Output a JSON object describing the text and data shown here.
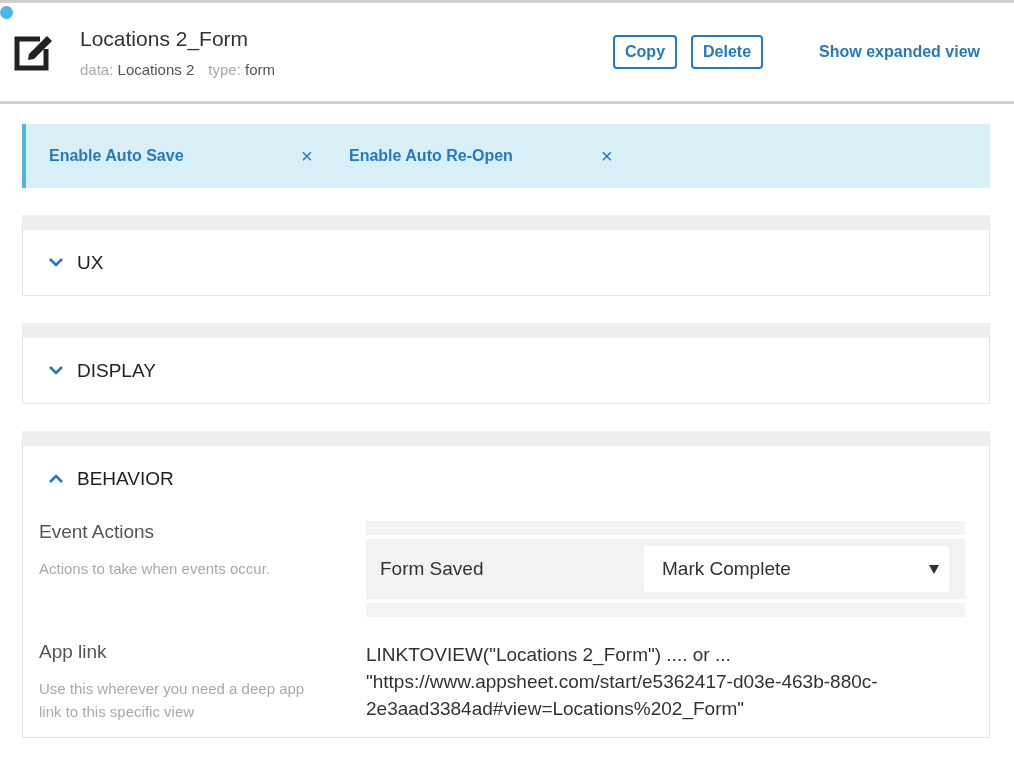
{
  "header": {
    "title": "Locations 2_Form",
    "meta": [
      {
        "label": "data:",
        "value": "Locations 2"
      },
      {
        "label": "type:",
        "value": "form"
      }
    ],
    "buttons": [
      "Copy",
      "Delete"
    ],
    "link": "Show expanded view"
  },
  "banner": {
    "items": [
      {
        "label": "Enable Auto Save",
        "close": "×"
      },
      {
        "label": "Enable Auto Re-Open",
        "close": "×"
      }
    ]
  },
  "sections": [
    {
      "title": "UX",
      "expanded": false
    },
    {
      "title": "DISPLAY",
      "expanded": false
    },
    {
      "title": "BEHAVIOR",
      "expanded": true,
      "settings": [
        {
          "kind": "event-actions",
          "label": "Event Actions",
          "description": "Actions to take when events occur.",
          "event": "Form Saved",
          "action": "Mark Complete"
        },
        {
          "kind": "text",
          "label": "App link",
          "description": "Use this wherever you need a deep app link to this specific view",
          "lines": [
            "LINKTOVIEW(\"Locations 2_Form\") .... or ...",
            "\"https://www.appsheet.com/start/e5362417-d03e-463b-880c-2e3aad3384ad#view=Locations%202_Form\""
          ]
        }
      ]
    }
  ]
}
